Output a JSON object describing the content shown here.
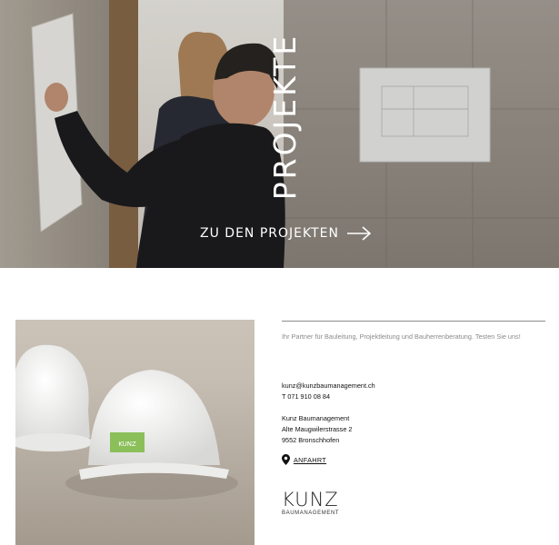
{
  "hero": {
    "title": "PROJEKTE",
    "cta_label": "ZU DEN PROJEKTEN"
  },
  "intro": {
    "tagline": "Ihr Partner für Bauleitung, Projektleitung und Bauherrenberatung. Testen Sie uns!"
  },
  "contact": {
    "email": "kunz@kunzbaumanagement.ch",
    "phone": "T 071 910 08 84"
  },
  "address": {
    "company": "Kunz Baumanagement",
    "street": "Alte Maugwilerstrasse 2",
    "city": "9552 Bronschhofen"
  },
  "directions": {
    "label": "ANFAHRT",
    "icon": "map-pin-icon"
  },
  "logo": {
    "wordmark": "KUNZ",
    "subline": "BAUMANAGEMENT"
  },
  "colors": {
    "helmet_label": "#8bbf5a",
    "concrete": "#a8a198",
    "text": "#111111",
    "muted_text": "#8a8a8a"
  }
}
